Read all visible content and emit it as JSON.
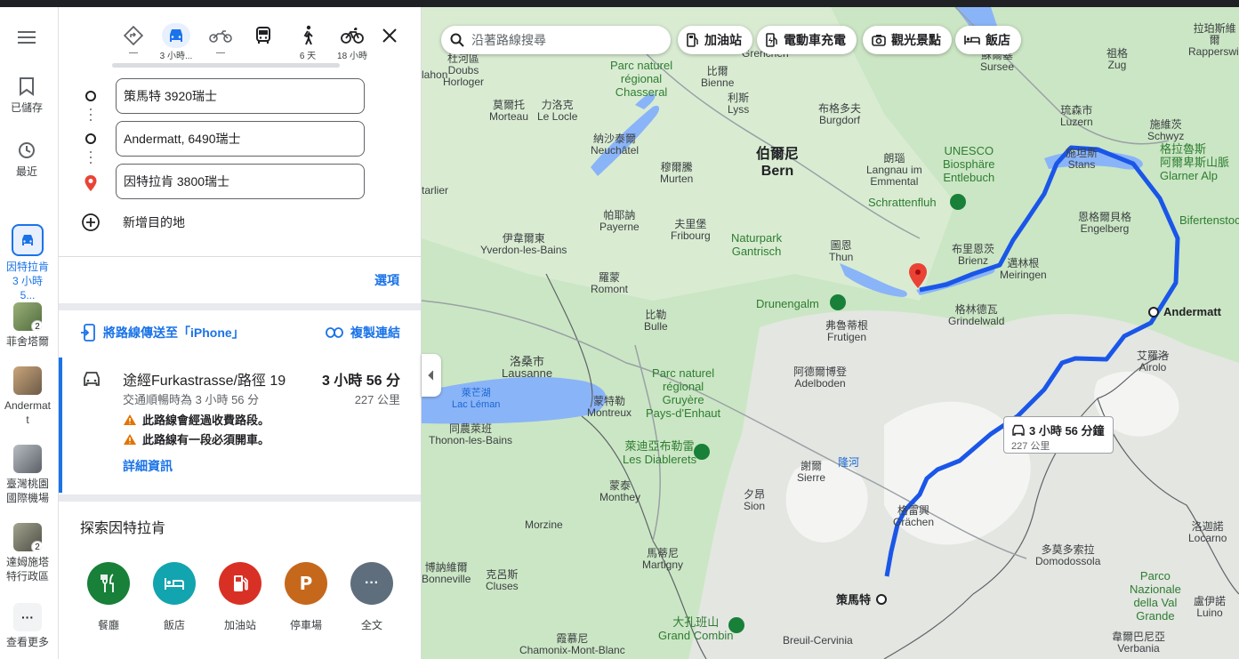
{
  "rail": {
    "saved_label": "已儲存",
    "recent_label": "最近",
    "recents": [
      {
        "label": "因特拉肯\n3 小時 5...",
        "active": true
      },
      {
        "label": "菲舍塔爾",
        "badge": "2"
      },
      {
        "label": "Andermat\nt"
      },
      {
        "label": "臺灣桃園\n國際機場"
      },
      {
        "label": "達姆施塔\n特行政區",
        "badge": "2"
      }
    ],
    "more_label": "查看更多"
  },
  "modes": [
    {
      "name": "best",
      "label": "—"
    },
    {
      "name": "drive",
      "label": "3 小時..."
    },
    {
      "name": "motorcycle",
      "label": "—"
    },
    {
      "name": "transit",
      "label": ""
    },
    {
      "name": "walk",
      "label": "6 天"
    },
    {
      "name": "bicycle",
      "label": "18 小時"
    }
  ],
  "stops": [
    "策馬特 3920瑞士",
    "Andermatt, 6490瑞士",
    "因特拉肯 3800瑞士"
  ],
  "add_destination": "新增目的地",
  "options_label": "選項",
  "send_to_phone": "將路線傳送至「iPhone」",
  "copy_link": "複製連結",
  "route": {
    "title": "途經Furkastrasse/路徑 19",
    "time": "3 小時 56 分",
    "traffic": "交通順暢時為 3 小時 56 分",
    "distance": "227 公里",
    "warnings": [
      "此路線會經過收費路段。",
      "此路線有一段必須開車。"
    ],
    "details": "詳細資訊"
  },
  "explore": {
    "title": "探索因特拉肯",
    "categories": [
      {
        "label": "餐廳",
        "color": "#188038"
      },
      {
        "label": "飯店",
        "color": "#12a4af"
      },
      {
        "label": "加油站",
        "color": "#d93025"
      },
      {
        "label": "停車場",
        "color": "#c5681c"
      },
      {
        "label": "全文",
        "color": "#5f6e7d"
      }
    ]
  },
  "map": {
    "search_placeholder": "沿著路線搜尋",
    "chips": [
      "加油站",
      "電動車充電",
      "觀光景點",
      "飯店"
    ],
    "eta": {
      "time": "3 小時 56 分鐘",
      "distance": "227 公里"
    },
    "labels": {
      "doubs": "杜河區\nDoubs\nHorloger",
      "chasseral": "Parc naturel\nrégional\nChasseral",
      "biel": "比爾\nBienne",
      "lyss": "利斯\nLyss",
      "burgdorf": "布格多夫\nBurgdorf",
      "morteau": "莫爾托\nMorteau",
      "lelocle": "力洛克\nLe Locle",
      "neuchatel": "納沙泰爾\nNeuchâtel",
      "murten": "穆爾騰\nMurten",
      "bern": "伯爾尼\nBern",
      "langnau": "朗瑙\nLangnau im\nEmmental",
      "unesco": "UNESCO\nBiosphäre\nEntlebuch",
      "schrattenfluh": "Schrattenfluh",
      "luzern": "琉森市\nLuzern",
      "stans": "施坦斯\nStans",
      "schwyz": "施維茨\nSchwyz",
      "glarner": "格拉魯斯\n阿爾卑斯山脈\nGlarner Alp",
      "bifertenstock": "Bifertenstock",
      "engelberg": "恩格爾貝格\nEngelberg",
      "brienz": "布里恩茨\nBrienz",
      "meiringen": "邁林根\nMeiringen",
      "thun": "圖恩\nThun",
      "payerne": "帕耶訥\nPayerne",
      "fribourg": "夫里堡\nFribourg",
      "gantrisch": "Naturpark\nGantrisch",
      "yverdon": "伊韋爾東\nYverdon-les-Bains",
      "romont": "羅蒙\nRomont",
      "drunengalm": "Drunengalm",
      "frutigen": "弗魯蒂根\nFrutigen",
      "grindelwald": "格林德瓦\nGrindelwald",
      "andermatt": "Andermatt",
      "airolo": "艾羅洛\nAirolo",
      "bulle": "比勒\nBulle",
      "lausanne": "洛桑市\nLausanne",
      "gruyere": "Parc naturel\nrégional\nGruyère\nPays-d'Enhaut",
      "adelboden": "阿德爾博登\nAdelboden",
      "leman": "萊芒湖\nLac Léman",
      "montreux": "蒙特勒\nMontreux",
      "thonon": "同農萊班\nThonon-les-Bains",
      "diablerets": "萊迪亞布勒雷\nLes Diablerets",
      "sierre": "謝爾\nSierre",
      "monthey": "蒙泰\nMonthey",
      "sion": "夕昂\nSion",
      "rhone": "隆河",
      "grachen": "格雷興\nGrächen",
      "morzine": "Morzine",
      "martigny": "馬蒂尼\nMartigny",
      "bonneville": "博訥維爾\nBonneville",
      "cluses": "克呂斯\nCluses",
      "domodossola": "多莫多索拉\nDomodossola",
      "valgrande": "Parco\nNazionale\ndella Val\nGrande",
      "zermatt": "策馬特",
      "grandcombin": "大孔班山\nGrand Combin",
      "chamonix": "霞慕尼\nChamonix-Mont-Blanc",
      "cervinia": "Breuil-Cervinia",
      "verbania": "韋爾巴尼亞\nVerbania",
      "locarno": "洛迦諾\nLocarno",
      "luino": "盧伊諾\nLuino",
      "sursee": "蘇爾塞\nSursee",
      "zug": "祖格\nZug",
      "rapperswil": "拉珀斯維爾\nRapperswil",
      "grenchen": "Grenchen",
      "lahon": "lahon",
      "tarlier": "tarlier"
    }
  }
}
